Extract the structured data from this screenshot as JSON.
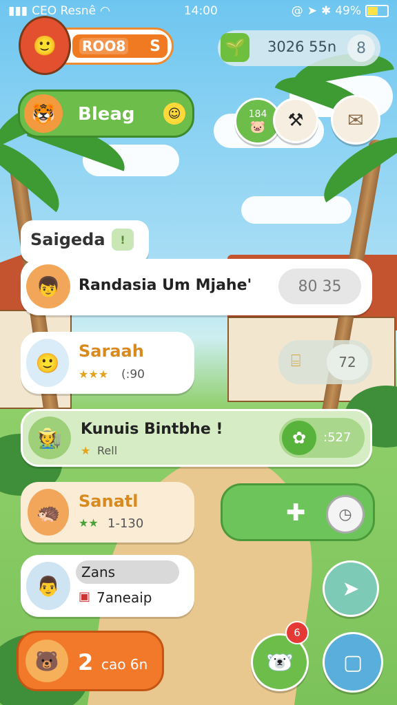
{
  "status_bar": {
    "carrier": "CEO Resnê",
    "time": "14:00",
    "battery": "49%",
    "battery_level": 0.49
  },
  "top": {
    "currency_label": "ROO8",
    "currency_icon": "S",
    "coins_text": "3026 55n",
    "coins_icon": "sprout-icon",
    "menu_icon": "8"
  },
  "player_bar": {
    "label": "Bleag"
  },
  "badge_counter": {
    "value": "184"
  },
  "section": {
    "title": "Saigeda"
  },
  "rows": [
    {
      "name": "Randasia Um Mjahe'",
      "value": "80 35"
    },
    {
      "name": "Saraah",
      "stars": "(:90"
    },
    {
      "name": "Kunuis Bintbhe !",
      "sub": "Rell",
      "value": ":527"
    },
    {
      "name": "Sanatl",
      "stars": "1-130"
    },
    {
      "name": "Zans",
      "sub": "7aneaip"
    }
  ],
  "right_buttons": {
    "button_2": "72"
  },
  "bottom_bar": {
    "counter": "2",
    "label": "cao 6n",
    "notification": "6"
  }
}
